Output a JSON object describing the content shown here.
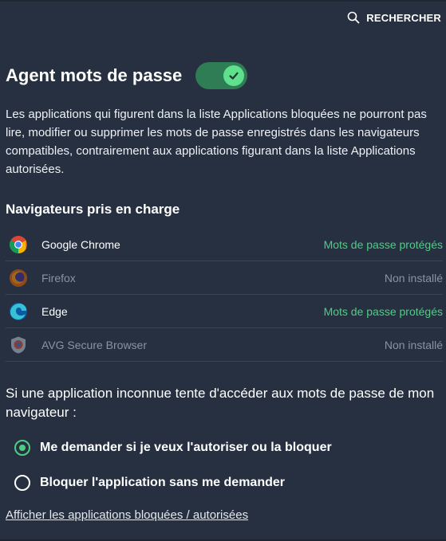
{
  "header": {
    "search_label": "RECHERCHER",
    "title": "Agent mots de passe",
    "toggle_on": true
  },
  "description": "Les applications qui figurent dans la liste Applications bloquées ne pourront pas lire, modifier ou supprimer les mots de passe enregistrés dans les navigateurs compatibles, contrairement aux applications figurant dans la liste Applications autorisées.",
  "browsers": {
    "title": "Navigateurs pris en charge",
    "items": [
      {
        "name": "Google Chrome",
        "status": "Mots de passe protégés",
        "installed": true,
        "icon": "chrome-icon"
      },
      {
        "name": "Firefox",
        "status": "Non installé",
        "installed": false,
        "icon": "firefox-icon"
      },
      {
        "name": "Edge",
        "status": "Mots de passe protégés",
        "installed": true,
        "icon": "edge-icon"
      },
      {
        "name": "AVG Secure Browser",
        "status": "Non installé",
        "installed": false,
        "icon": "avg-browser-icon"
      }
    ]
  },
  "question": "Si une application inconnue tente d'accéder aux mots de passe de mon navigateur :",
  "options": [
    {
      "label": "Me demander si je veux l'autoriser ou la bloquer",
      "selected": true
    },
    {
      "label": "Bloquer l'application sans me demander",
      "selected": false
    }
  ],
  "link": "Afficher les applications bloquées / autorisées",
  "colors": {
    "background": "#263040",
    "accent_green": "#4dce83",
    "toggle_track": "#2f7d55"
  }
}
